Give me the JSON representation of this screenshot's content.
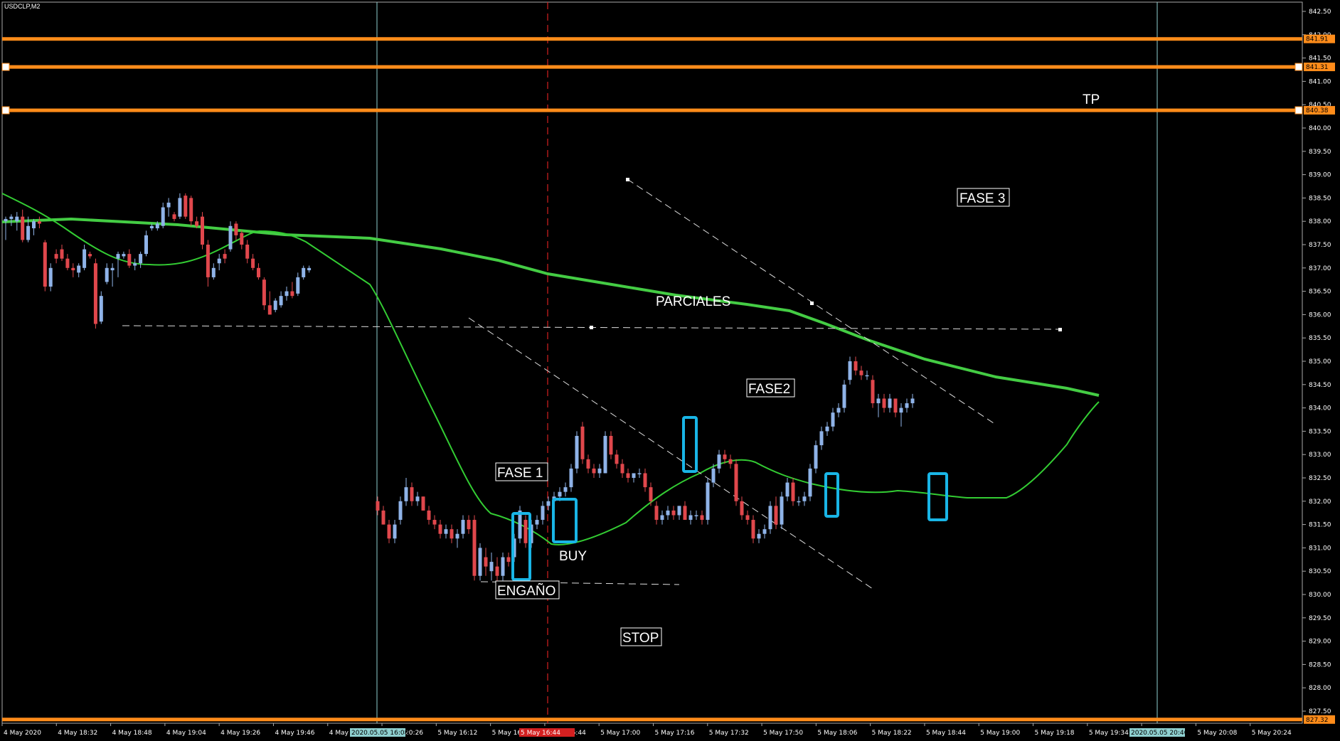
{
  "window": {
    "symbol": "USDCLP,M2"
  },
  "annotations": {
    "tp": "TP",
    "fase3": "FASE 3",
    "parciales": "PARCIALES",
    "fase2": "FASE2",
    "fase1": "FASE 1",
    "buy": "BUY",
    "engano": "ENGAÑO",
    "stop": "STOP"
  },
  "price_axis": {
    "ticks": [
      "842.50",
      "842.00",
      "841.50",
      "841.00",
      "840.50",
      "840.00",
      "839.50",
      "839.00",
      "838.50",
      "838.00",
      "837.50",
      "837.00",
      "836.50",
      "836.00",
      "835.50",
      "835.00",
      "834.50",
      "834.00",
      "833.50",
      "833.00",
      "832.50",
      "832.00",
      "831.50",
      "831.00",
      "830.50",
      "830.00",
      "829.50",
      "829.00",
      "828.50",
      "828.00",
      "827.50"
    ],
    "level_labels": [
      "841.91",
      "841.31",
      "840.38",
      "827.32"
    ]
  },
  "time_axis": {
    "ticks": [
      "4 May 2020",
      "4 May 18:32",
      "4 May 18:48",
      "4 May 19:04",
      "4 May 19:26",
      "4 May 19:46",
      "4 May 20:06",
      "4 May 20:26",
      "5 May 16:12",
      "5 May 16:28",
      "5 May 16:44",
      "5 May 17:00",
      "5 May 17:16",
      "5 May 17:32",
      "5 May 17:50",
      "5 May 18:06",
      "5 May 18:22",
      "5 May 18:44",
      "5 May 19:00",
      "5 May 19:18",
      "5 May 19:34",
      "5 May 19:52",
      "5 May 20:08",
      "5 May 20:24"
    ],
    "marker_labels": [
      "2020.05.05 16:08",
      "5 May 16:44",
      "2020.05.05 20:46"
    ]
  },
  "colors": {
    "background": "#000000",
    "bull_candle": "#8fb3e8",
    "bear_candle": "#e0474c",
    "ma_fast": "#33cc33",
    "ma_slow": "#44cc44",
    "level_line": "#ff8c1a",
    "highlight_box": "#19b5e6",
    "vertical_marker": "#8fd0d0",
    "current_marker": "#d42020"
  },
  "chart_data": {
    "type": "candlestick",
    "price_range": [
      827.25,
      842.65
    ],
    "levels": [
      841.91,
      841.31,
      840.38,
      827.32
    ],
    "candles": [
      {
        "o": 838.0,
        "h": 838.1,
        "l": 837.6,
        "c": 838.05
      },
      {
        "o": 838.05,
        "h": 838.15,
        "l": 837.9,
        "c": 838.1
      },
      {
        "o": 838.0,
        "h": 838.2,
        "l": 837.8,
        "c": 838.1
      },
      {
        "o": 838.1,
        "h": 838.25,
        "l": 837.55,
        "c": 837.6
      },
      {
        "o": 837.6,
        "h": 838.1,
        "l": 837.55,
        "c": 837.9
      },
      {
        "o": 837.85,
        "h": 838.05,
        "l": 837.7,
        "c": 838.0
      },
      {
        "o": 838.0,
        "h": 838.1,
        "l": 837.85,
        "c": 837.95
      },
      {
        "o": 837.55,
        "h": 837.6,
        "l": 836.5,
        "c": 836.6
      },
      {
        "o": 836.6,
        "h": 837.1,
        "l": 836.5,
        "c": 837.0
      },
      {
        "o": 837.3,
        "h": 837.4,
        "l": 837.1,
        "c": 837.2
      },
      {
        "o": 837.4,
        "h": 837.5,
        "l": 837.15,
        "c": 837.2
      },
      {
        "o": 837.2,
        "h": 837.3,
        "l": 836.95,
        "c": 837.0
      },
      {
        "o": 837.0,
        "h": 837.1,
        "l": 836.8,
        "c": 836.95
      },
      {
        "o": 836.9,
        "h": 837.1,
        "l": 836.8,
        "c": 837.05
      },
      {
        "o": 837.0,
        "h": 837.5,
        "l": 836.95,
        "c": 837.4
      },
      {
        "o": 837.3,
        "h": 837.35,
        "l": 837.2,
        "c": 837.25
      },
      {
        "o": 837.1,
        "h": 837.2,
        "l": 835.7,
        "c": 835.8
      },
      {
        "o": 835.85,
        "h": 836.5,
        "l": 835.8,
        "c": 836.4
      },
      {
        "o": 836.7,
        "h": 837.1,
        "l": 836.65,
        "c": 837.0
      },
      {
        "o": 836.95,
        "h": 837.1,
        "l": 836.6,
        "c": 837.0
      },
      {
        "o": 837.2,
        "h": 837.35,
        "l": 836.8,
        "c": 837.3
      },
      {
        "o": 837.25,
        "h": 837.35,
        "l": 837.2,
        "c": 837.3
      },
      {
        "o": 837.3,
        "h": 837.4,
        "l": 837.0,
        "c": 837.05
      },
      {
        "o": 837.05,
        "h": 837.2,
        "l": 836.95,
        "c": 837.1
      },
      {
        "o": 837.1,
        "h": 837.35,
        "l": 837.0,
        "c": 837.3
      },
      {
        "o": 837.3,
        "h": 837.8,
        "l": 837.25,
        "c": 837.7
      },
      {
        "o": 837.85,
        "h": 837.95,
        "l": 837.8,
        "c": 837.9
      },
      {
        "o": 837.85,
        "h": 838.0,
        "l": 837.8,
        "c": 837.95
      },
      {
        "o": 837.9,
        "h": 838.4,
        "l": 837.85,
        "c": 838.3
      },
      {
        "o": 838.3,
        "h": 838.5,
        "l": 838.1,
        "c": 838.4
      },
      {
        "o": 838.15,
        "h": 838.2,
        "l": 838.0,
        "c": 838.05
      },
      {
        "o": 838.1,
        "h": 838.6,
        "l": 838.05,
        "c": 838.5
      },
      {
        "o": 838.55,
        "h": 838.6,
        "l": 838.05,
        "c": 838.1
      },
      {
        "o": 838.5,
        "h": 838.55,
        "l": 837.9,
        "c": 838.0
      },
      {
        "o": 838.0,
        "h": 838.1,
        "l": 837.85,
        "c": 837.9
      },
      {
        "o": 838.1,
        "h": 838.2,
        "l": 837.4,
        "c": 837.5
      },
      {
        "o": 837.5,
        "h": 837.6,
        "l": 836.6,
        "c": 836.8
      },
      {
        "o": 836.8,
        "h": 837.1,
        "l": 836.75,
        "c": 837.0
      },
      {
        "o": 837.1,
        "h": 837.3,
        "l": 836.95,
        "c": 837.2
      },
      {
        "o": 837.3,
        "h": 837.4,
        "l": 837.1,
        "c": 837.2
      },
      {
        "o": 837.4,
        "h": 838.0,
        "l": 837.35,
        "c": 837.9
      },
      {
        "o": 837.95,
        "h": 838.0,
        "l": 837.6,
        "c": 837.7
      },
      {
        "o": 837.75,
        "h": 837.8,
        "l": 837.4,
        "c": 837.5
      },
      {
        "o": 837.5,
        "h": 837.6,
        "l": 837.1,
        "c": 837.2
      },
      {
        "o": 837.2,
        "h": 837.3,
        "l": 836.95,
        "c": 837.0
      },
      {
        "o": 837.0,
        "h": 837.1,
        "l": 836.75,
        "c": 836.8
      },
      {
        "o": 836.75,
        "h": 836.8,
        "l": 836.1,
        "c": 836.2
      },
      {
        "o": 836.2,
        "h": 836.5,
        "l": 836.0,
        "c": 836.0
      },
      {
        "o": 836.1,
        "h": 836.35,
        "l": 836.05,
        "c": 836.3
      },
      {
        "o": 836.2,
        "h": 836.5,
        "l": 836.15,
        "c": 836.4
      },
      {
        "o": 836.4,
        "h": 836.6,
        "l": 836.3,
        "c": 836.5
      },
      {
        "o": 836.5,
        "h": 836.7,
        "l": 836.35,
        "c": 836.4
      },
      {
        "o": 836.45,
        "h": 836.9,
        "l": 836.4,
        "c": 836.8
      },
      {
        "o": 836.8,
        "h": 837.05,
        "l": 836.75,
        "c": 837.0
      },
      {
        "o": 836.95,
        "h": 837.05,
        "l": 836.9,
        "c": 837.0
      }
    ]
  }
}
